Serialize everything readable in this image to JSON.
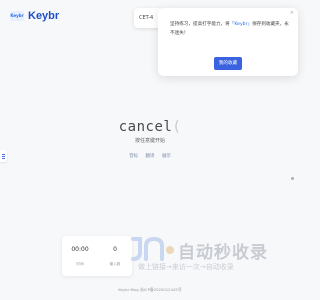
{
  "header": {
    "logo_badge": "Keybr",
    "logo_text": "Keybr",
    "lang_selector": "CET-4"
  },
  "popup": {
    "close_glyph": "×",
    "text_before": "坚持练习，提高打字能力，将",
    "link_text": "「Keybr」",
    "text_after": "保存到收藏夹，永不迷失！",
    "button_label": "我的收藏"
  },
  "practice": {
    "typed": "cancel",
    "cursor": "(",
    "hint": "按任意键开始",
    "links": [
      "音标",
      "翻译",
      "展示"
    ]
  },
  "stats": {
    "time": "00:00",
    "time_label": "时间",
    "count": "0",
    "count_label": "输入数"
  },
  "watermark": {
    "main": "自动秒收录",
    "sub": "做上链接→来访一次→自动收录"
  },
  "footer": {
    "text": "Keybr Blog  浙ICP备2020012445号"
  }
}
